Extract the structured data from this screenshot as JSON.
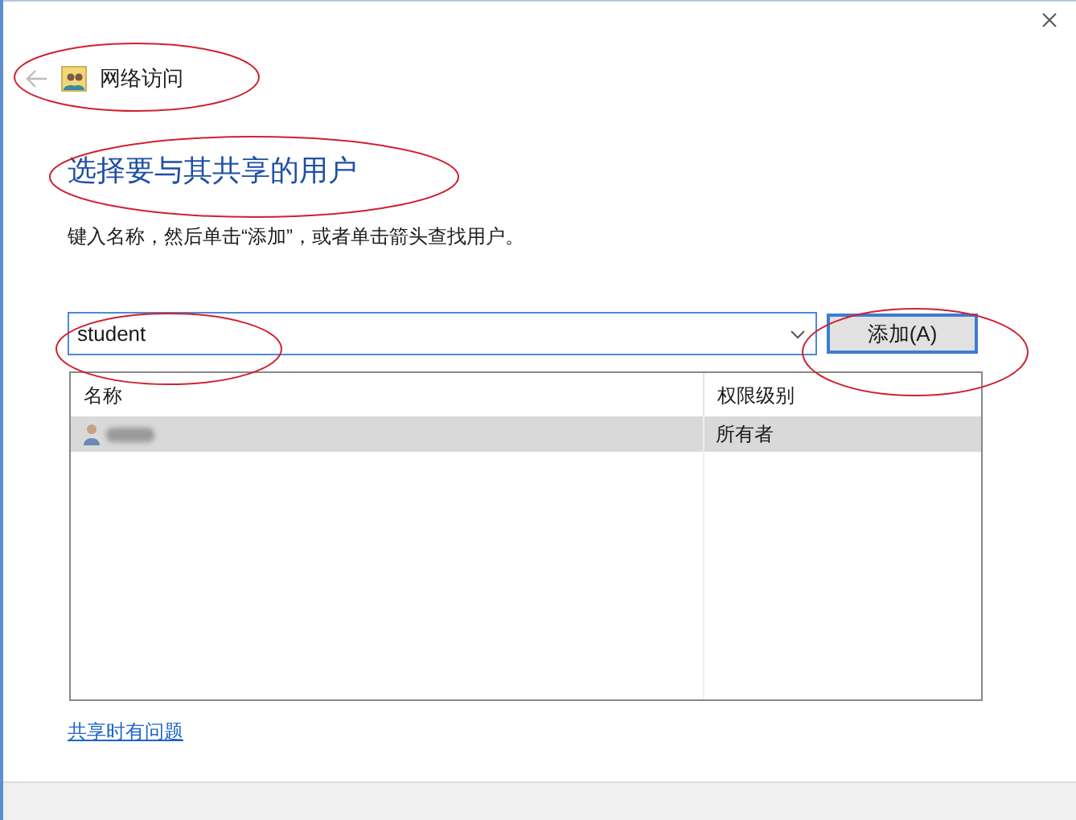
{
  "window": {
    "title": "网络访问"
  },
  "heading": "选择要与其共享的用户",
  "instruction": "键入名称，然后单击“添加”，或者单击箭头查找用户。",
  "name_field": {
    "value": "student"
  },
  "add_button": "添加(A)",
  "table": {
    "columns": [
      "名称",
      "权限级别"
    ],
    "rows": [
      {
        "permission": "所有者",
        "selected": true
      }
    ]
  },
  "help_link": "共享时有问题"
}
